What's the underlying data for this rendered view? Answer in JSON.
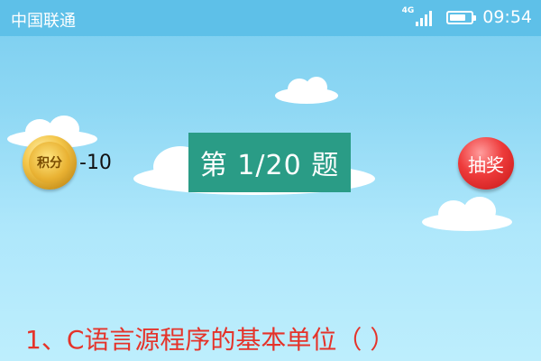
{
  "status_bar": {
    "carrier": "中国联通",
    "network_type": "4G",
    "signal_level": 4,
    "battery_level": 0.75,
    "time": "09:54"
  },
  "game": {
    "points_label": "积分",
    "points_value": "-10",
    "question_counter": "第 1/20 题",
    "lottery_label": "抽奖",
    "question_text": "1、C语言源程序的基本单位（  ）"
  },
  "colors": {
    "status_bar": "#5ec0e8",
    "question_box": "#2a9c86",
    "question_text": "#e5332a",
    "lottery_button": "#ee3b3b",
    "coin": "#f4c64a"
  },
  "icons": [
    "signal-icon",
    "battery-icon",
    "coin-icon",
    "cloud-icon"
  ]
}
